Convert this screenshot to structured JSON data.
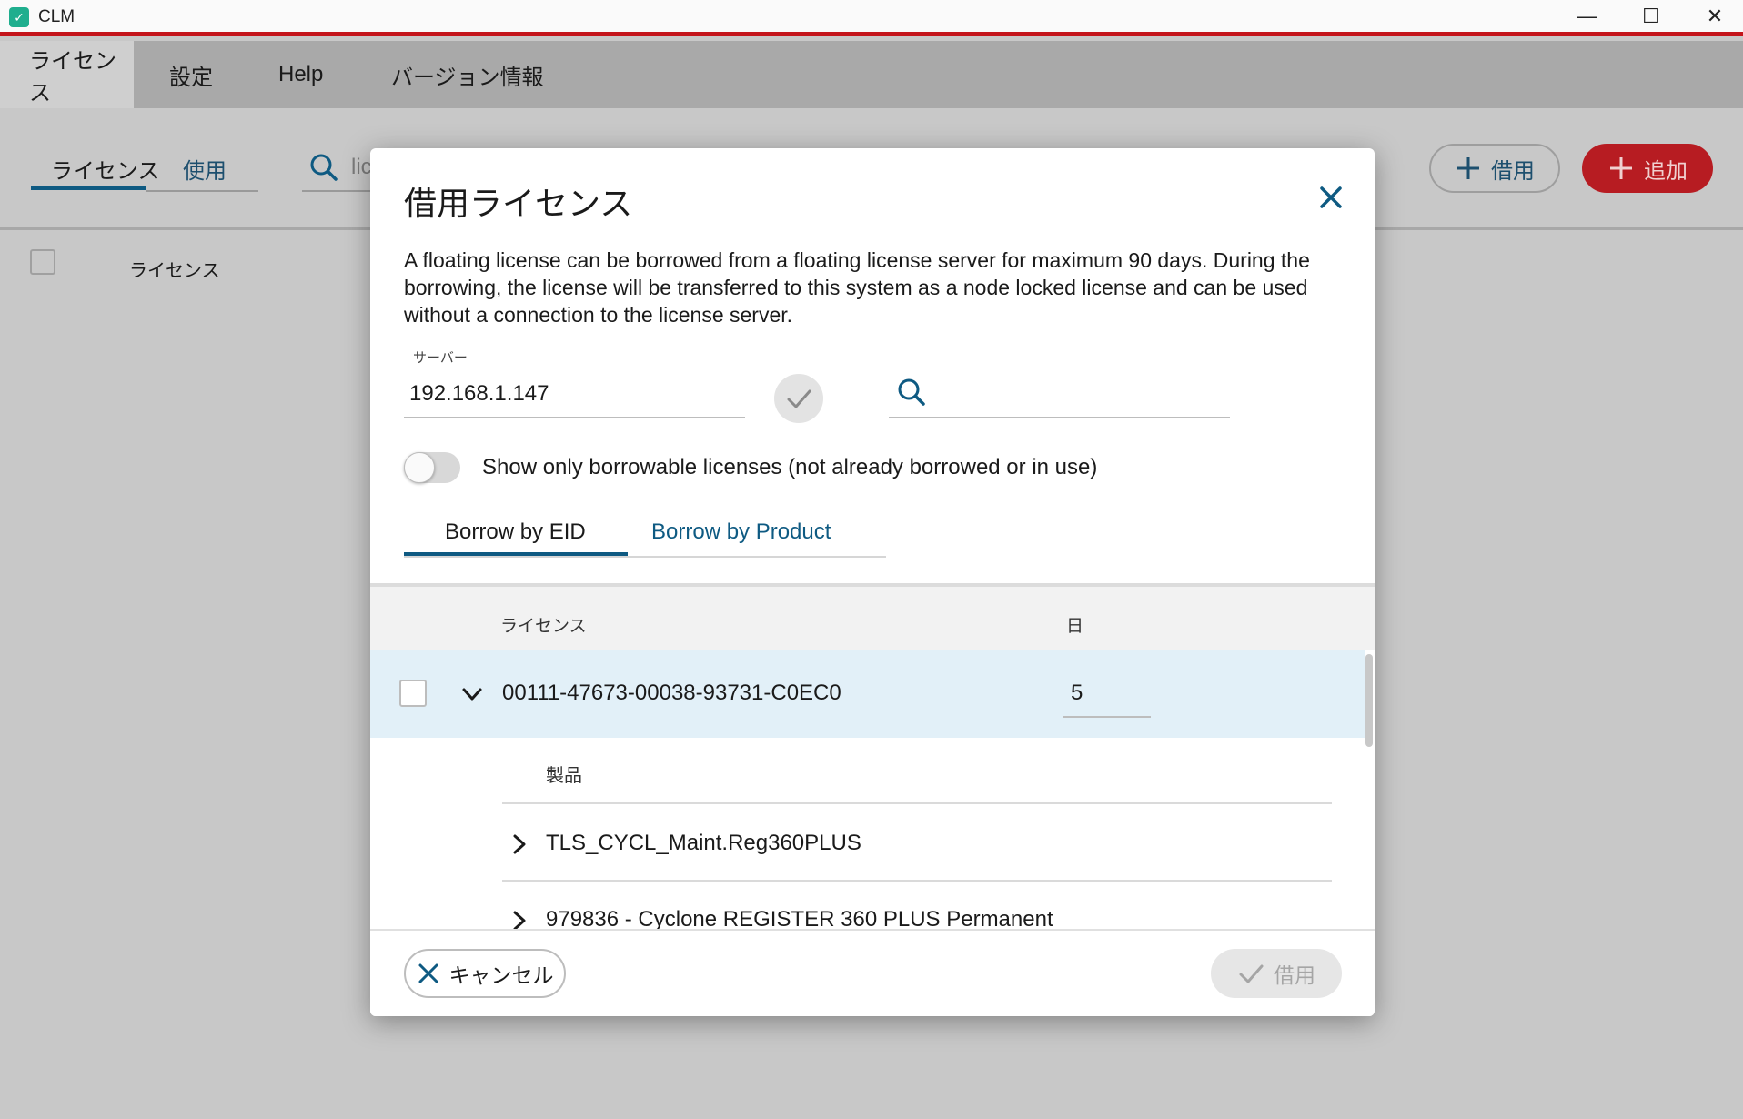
{
  "window": {
    "title": "CLM",
    "minimize_glyph": "—",
    "maximize_glyph": "☐",
    "close_glyph": "✕"
  },
  "menu": [
    {
      "label": "ライセンス"
    },
    {
      "label": "設定"
    },
    {
      "label": "Help"
    },
    {
      "label": "バージョン情報"
    }
  ],
  "subtabs": [
    {
      "label": "ライセンス"
    },
    {
      "label": "使用"
    }
  ],
  "bg_search": {
    "text": "lic"
  },
  "actions": {
    "borrow_label": "借用",
    "add_label": "追加"
  },
  "bg_table": {
    "column_license": "ライセンス"
  },
  "modal": {
    "title": "借用ライセンス",
    "description": "A floating license can be borrowed from a floating license server for maximum 90 days. During the borrowing, the license will be transferred to this system as a node locked license and can be used without a connection to the license server.",
    "server_label": "サーバー",
    "server_value": "192.168.1.147",
    "filter_placeholder": "",
    "toggle_label": "Show only borrowable licenses (not already borrowed or in use)",
    "tabs": [
      {
        "label": "Borrow by EID"
      },
      {
        "label": "Borrow by Product"
      }
    ],
    "table": {
      "col_license": "ライセンス",
      "col_days": "日",
      "rows": [
        {
          "license": "00111-47673-00038-93731-C0EC0",
          "days": "5",
          "products_header": "製品",
          "products": [
            {
              "label": "TLS_CYCL_Maint.Reg360PLUS"
            },
            {
              "label": "979836 - Cyclone REGISTER 360 PLUS Permanent"
            }
          ]
        }
      ]
    },
    "cancel_label": "キャンセル",
    "borrow_label": "借用"
  },
  "colors": {
    "accent": "#0e5a82",
    "brand_red": "#c4141b",
    "row_highlight": "#e2f0f8"
  },
  "icons": [
    "app-logo-icon",
    "minimize-icon",
    "maximize-icon",
    "close-icon",
    "search-icon",
    "plus-icon",
    "check-icon",
    "chevron-down-icon",
    "chevron-right-icon"
  ]
}
